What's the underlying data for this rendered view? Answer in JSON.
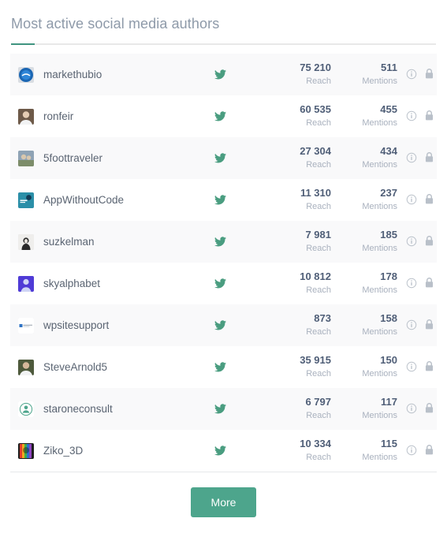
{
  "card": {
    "title": "Most active social media authors",
    "accent_color": "#3f9480",
    "row_shade_color": "#f9f9fa"
  },
  "columns": {
    "reach_label": "Reach",
    "mentions_label": "Mentions"
  },
  "icons": {
    "network": "twitter-bird-icon",
    "info": "info-circle-icon",
    "lock": "lock-icon",
    "network_color": "#4a9d80"
  },
  "authors": [
    {
      "name": "markethubio",
      "network": "Twitter",
      "reach": "75 210",
      "mentions": "511",
      "avatar_bg": "#1b66b3",
      "avatar_fg": "#ffffff",
      "avatar_kind": "logo-circle"
    },
    {
      "name": "ronfeir",
      "network": "Twitter",
      "reach": "60 535",
      "mentions": "455",
      "avatar_bg": "#6e5a49",
      "avatar_fg": "#e6cdb4",
      "avatar_kind": "photo-person"
    },
    {
      "name": "5foottraveler",
      "network": "Twitter",
      "reach": "27 304",
      "mentions": "434",
      "avatar_bg": "#8fa3b5",
      "avatar_fg": "#d8c7ae",
      "avatar_kind": "photo-outdoor"
    },
    {
      "name": "AppWithoutCode",
      "network": "Twitter",
      "reach": "11 310",
      "mentions": "237",
      "avatar_bg": "#2b8fa8",
      "avatar_fg": "#ffffff",
      "avatar_kind": "brand-teal"
    },
    {
      "name": "suzkelman",
      "network": "Twitter",
      "reach": "7 981",
      "mentions": "185",
      "avatar_bg": "#efeeec",
      "avatar_fg": "#2a2a2a",
      "avatar_kind": "photo-portrait"
    },
    {
      "name": "skyalphabet",
      "network": "Twitter",
      "reach": "10 812",
      "mentions": "178",
      "avatar_bg": "#4f3bd6",
      "avatar_fg": "#cfd4f5",
      "avatar_kind": "avatar-purple"
    },
    {
      "name": "wpsitesupport",
      "network": "Twitter",
      "reach": "873",
      "mentions": "158",
      "avatar_bg": "#ffffff",
      "avatar_fg": "#2f73c4",
      "avatar_kind": "logo-wordmark"
    },
    {
      "name": "SteveArnold5",
      "network": "Twitter",
      "reach": "35 915",
      "mentions": "150",
      "avatar_bg": "#4e5a3c",
      "avatar_fg": "#d6b89a",
      "avatar_kind": "photo-person"
    },
    {
      "name": "staroneconsult",
      "network": "Twitter",
      "reach": "6 797",
      "mentions": "117",
      "avatar_bg": "#ffffff",
      "avatar_fg": "#4da58c",
      "avatar_kind": "badge-green"
    },
    {
      "name": "Ziko_3D",
      "network": "Twitter",
      "reach": "10 334",
      "mentions": "115",
      "avatar_bg": "#1d1d1d",
      "avatar_fg": "#ff3b30",
      "avatar_kind": "avatar-rainbow"
    }
  ],
  "footer": {
    "more_label": "More",
    "more_color": "#4da58c"
  }
}
